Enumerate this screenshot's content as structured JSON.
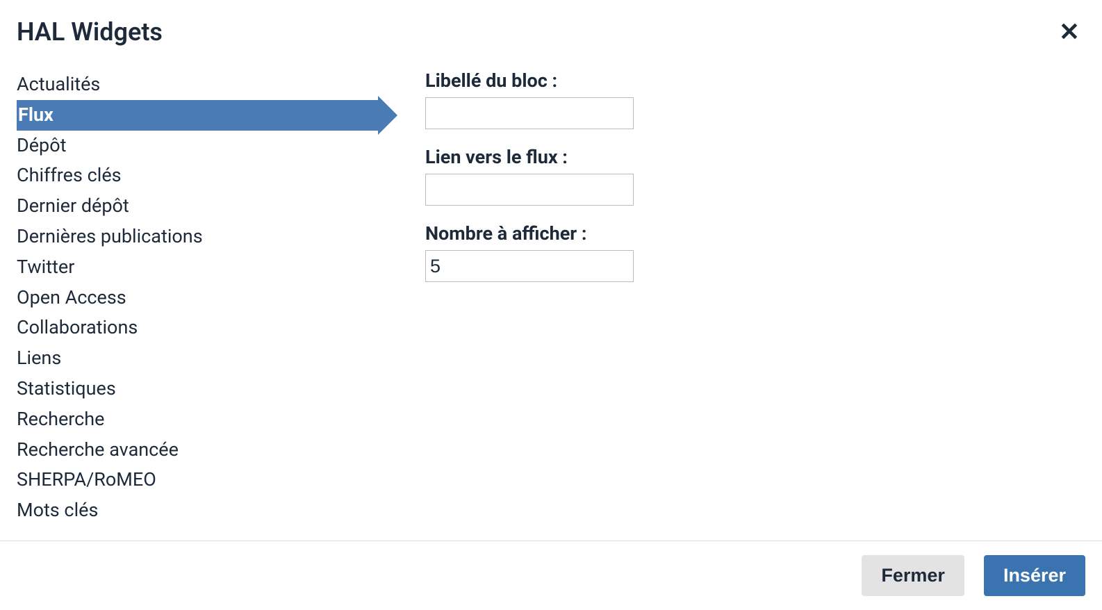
{
  "dialog": {
    "title": "HAL Widgets"
  },
  "sidebar": {
    "items": [
      {
        "label": "Actualités",
        "active": false
      },
      {
        "label": "Flux",
        "active": true
      },
      {
        "label": "Dépôt",
        "active": false
      },
      {
        "label": "Chiffres clés",
        "active": false
      },
      {
        "label": "Dernier dépôt",
        "active": false
      },
      {
        "label": "Dernières publications",
        "active": false
      },
      {
        "label": "Twitter",
        "active": false
      },
      {
        "label": "Open Access",
        "active": false
      },
      {
        "label": "Collaborations",
        "active": false
      },
      {
        "label": "Liens",
        "active": false
      },
      {
        "label": "Statistiques",
        "active": false
      },
      {
        "label": "Recherche",
        "active": false
      },
      {
        "label": "Recherche avancée",
        "active": false
      },
      {
        "label": "SHERPA/RoMEO",
        "active": false
      },
      {
        "label": "Mots clés",
        "active": false
      }
    ]
  },
  "form": {
    "block_label": {
      "label": "Libellé du bloc :",
      "value": ""
    },
    "feed_link": {
      "label": "Lien vers le flux :",
      "value": ""
    },
    "display_count": {
      "label": "Nombre à afficher :",
      "value": "5"
    }
  },
  "footer": {
    "close_label": "Fermer",
    "insert_label": "Insérer"
  }
}
